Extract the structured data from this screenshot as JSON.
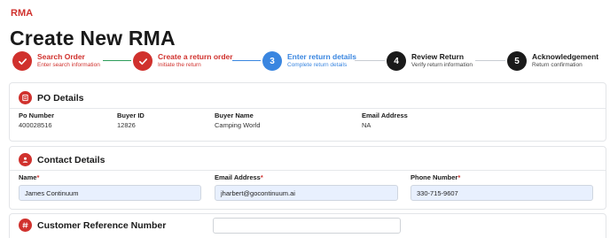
{
  "app": {
    "brand": "RMA",
    "title": "Create New RMA"
  },
  "steps": [
    {
      "number": "1",
      "title": "Search Order",
      "subtitle": "Enter search information",
      "state": "done"
    },
    {
      "number": "2",
      "title": "Create a return order",
      "subtitle": "Initiate the return",
      "state": "done"
    },
    {
      "number": "3",
      "title": "Enter return details",
      "subtitle": "Complete return details",
      "state": "active"
    },
    {
      "number": "4",
      "title": "Review Return",
      "subtitle": "Verify return information",
      "state": "pending"
    },
    {
      "number": "5",
      "title": "Acknowledgement",
      "subtitle": "Return confirmation",
      "state": "pending"
    }
  ],
  "po_details": {
    "title": "PO Details",
    "fields": [
      {
        "label": "Po Number",
        "value": "400028516"
      },
      {
        "label": "Buyer ID",
        "value": "12826"
      },
      {
        "label": "Buyer Name",
        "value": "Camping World"
      },
      {
        "label": "Email Address",
        "value": "NA"
      }
    ]
  },
  "contact_details": {
    "title": "Contact Details",
    "fields": [
      {
        "label": "Name",
        "required_mark": "*",
        "value": "James Continuum"
      },
      {
        "label": "Email Address",
        "required_mark": "*",
        "value": "jharbert@gocontinuum.ai"
      },
      {
        "label": "Phone Number",
        "required_mark": "*",
        "value": "330-715-9607"
      }
    ]
  },
  "customer_reference": {
    "title": "Customer Reference Number",
    "value": ""
  },
  "colors": {
    "brand_red": "#d0312d",
    "active_blue": "#3a86e0",
    "done_green": "#2e9e5b",
    "input_bg": "#e8f0fe"
  }
}
